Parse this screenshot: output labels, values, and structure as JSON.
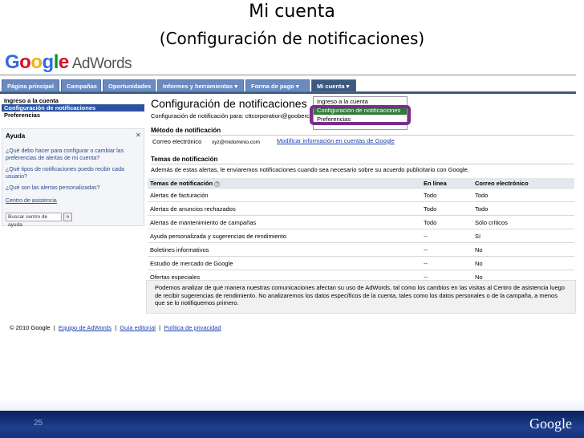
{
  "slide": {
    "title": "Mi cuenta",
    "subtitle": "(Configuración de notificaciones)",
    "page_number": "25",
    "brand": "Google"
  },
  "logo": {
    "text_g": "G",
    "text_o1": "o",
    "text_o2": "o",
    "text_g2": "g",
    "text_l": "l",
    "text_e": "e",
    "product": "AdWords"
  },
  "tabs": [
    {
      "label": "Página principal"
    },
    {
      "label": "Campañas"
    },
    {
      "label": "Oportunidades"
    },
    {
      "label": "Informes y herramientas ▾"
    },
    {
      "label": "Forma de pago ▾"
    },
    {
      "label": "Mi cuenta ▾"
    }
  ],
  "left_nav": {
    "items": [
      "Ingreso a la cuenta",
      "Configuración de notificaciones",
      "Preferencias"
    ]
  },
  "help": {
    "title": "Ayuda",
    "close": "✕",
    "q1": "¿Qué debo hacer para configurar o cambiar las preferencias de alertas de mi cuenta?",
    "q2": "¿Qué tipos de notificaciones puedo recibir cada usuario?",
    "q3": "¿Qué son las alertas personalizadas?",
    "center_link": "Centro de asistencia",
    "search_placeholder": "Buscar centro de ayuda",
    "search_button": "»"
  },
  "main": {
    "title": "Configuración de notificaciones",
    "notif_line": "Configuración de notificación para: cttcorporation@gooberc",
    "method_title": "Método de notificación",
    "email_label": "Correo electrónico",
    "email_value": "xyz@midominio.com",
    "email_link": "Modificar información en cuentas de Google",
    "topics_title": "Temas de notificación",
    "topics_note": "Además de estas alertas, le enviaremos notificaciones cuando sea necesario sobre su acuerdo publicitario con Google."
  },
  "table": {
    "headers": [
      "Temas de notificación",
      "En línea",
      "Correo electrónico"
    ],
    "rows": [
      [
        "Alertas de facturación",
        "Todo",
        "Todo"
      ],
      [
        "Alertas de anuncios rechazados",
        "Todo",
        "Todo"
      ],
      [
        "Alertas de mantenimiento de campañas",
        "Todo",
        "Sólo críticos"
      ],
      [
        "Ayuda personalizada y sugerencias de rendimiento",
        "--",
        "Sí"
      ],
      [
        "Boletines informativos",
        "--",
        "No"
      ],
      [
        "Estudio de mercado de Google",
        "--",
        "No"
      ],
      [
        "Ofertas especiales",
        "--",
        "No"
      ]
    ]
  },
  "infobox": "Podemos analizar de qué manera nuestras comunicaciones afectan su uso de AdWords, tal como los cambios en las visitas al Centro de asistencia luego de recibir sugerencias de rendimiento. No analizaremos los datos específicos de la cuenta, tales como los datos personales o de la campaña, a menos que se lo notifiquemos primero.",
  "footer": {
    "copyright": "© 2010 Google",
    "link1": "Equipo de AdWords",
    "link2": "Guía editorial",
    "link3": "Política de privacidad"
  },
  "dropdown": {
    "items": [
      "Ingreso a la cuenta",
      "Configuración de notificaciones",
      "Preferencias"
    ]
  },
  "colors": {
    "highlight": "#7b2c8c",
    "tab_blue": "#6a8ac0",
    "nav_selected": "#2a52a0"
  }
}
